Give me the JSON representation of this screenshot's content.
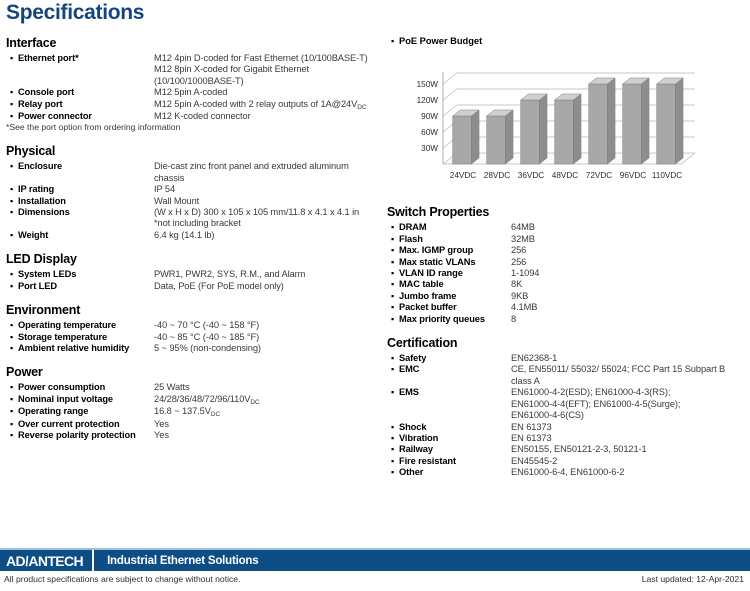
{
  "page": {
    "title": "Specifications"
  },
  "left_sections": [
    {
      "title": "Interface",
      "rows": [
        {
          "label": "Ethernet port*",
          "value_lines": [
            "M12 4pin D-coded for Fast Ethernet (10/100BASE-T)",
            "M12 8pin X-coded for Gigabit Ethernet",
            "(10/100/1000BASE-T)"
          ]
        },
        {
          "label": "Console port",
          "value_lines": [
            "M12 5pin A-coded"
          ]
        },
        {
          "label": "Relay port",
          "value_lines": [
            "M12 5pin A-coded with 2 relay outputs of 1A@24V<sub>DC</sub>"
          ]
        },
        {
          "label": "Power connector",
          "value_lines": [
            "M12 K-coded connector"
          ]
        }
      ],
      "footnote": "*See the port option from ordering information"
    },
    {
      "title": "Physical",
      "rows": [
        {
          "label": "Enclosure",
          "value_lines": [
            "Die-cast zinc front panel and extruded aluminum",
            "chassis"
          ]
        },
        {
          "label": "IP rating",
          "value_lines": [
            "IP 54"
          ]
        },
        {
          "label": "Installation",
          "value_lines": [
            "Wall Mount"
          ]
        },
        {
          "label": "Dimensions",
          "value_lines": [
            "(W x H x D) 300 x 105 x 105 mm/11.8 x 4.1 x 4.1 in",
            "*not including bracket"
          ]
        },
        {
          "label": "Weight",
          "value_lines": [
            "6.4 kg (14.1 lb)"
          ]
        }
      ],
      "footnote": ""
    },
    {
      "title": "LED Display",
      "rows": [
        {
          "label": "System LEDs",
          "value_lines": [
            "PWR1, PWR2, SYS, R.M., and Alarm"
          ]
        },
        {
          "label": "Port LED",
          "value_lines": [
            "Data, PoE (For PoE model only)"
          ]
        }
      ],
      "footnote": ""
    },
    {
      "title": "Environment",
      "rows": [
        {
          "label": "Operating temperature",
          "value_lines": [
            "-40 ~ 70 °C (-40 ~ 158 °F)"
          ]
        },
        {
          "label": "Storage temperature",
          "value_lines": [
            "-40 ~ 85 °C (-40 ~ 185 °F)"
          ]
        },
        {
          "label": "Ambient relative humidity",
          "value_lines": [
            "5 ~ 95% (non-condensing)"
          ]
        }
      ],
      "footnote": ""
    },
    {
      "title": "Power",
      "rows": [
        {
          "label": "Power consumption",
          "value_lines": [
            "25 Watts"
          ]
        },
        {
          "label": "Nominal input voltage",
          "value_lines": [
            "24/28/36/48/72/96/110V<sub>DC</sub>"
          ]
        },
        {
          "label": "Operating range",
          "value_lines": [
            "16.8 ~ 137.5V<sub>DC</sub>"
          ]
        },
        {
          "label": "Over current protection",
          "value_lines": [
            "Yes"
          ]
        },
        {
          "label": "Reverse polarity protection",
          "value_lines": [
            "Yes"
          ]
        }
      ],
      "footnote": ""
    }
  ],
  "chart_header": "PoE Power Budget",
  "chart_data": {
    "type": "bar",
    "title": "PoE Power Budget",
    "categories": [
      "24VDC",
      "28VDC",
      "36VDC",
      "48VDC",
      "72VDC",
      "96VDC",
      "110VDC"
    ],
    "values": [
      90,
      90,
      120,
      120,
      150,
      150,
      150
    ],
    "xlabel": "",
    "ylabel": "",
    "ylim": [
      0,
      180
    ],
    "ytick_values": [
      30,
      60,
      90,
      120,
      150
    ],
    "ytick_labels": [
      "30W",
      "60W",
      "90W",
      "120W",
      "150W"
    ],
    "grid": true,
    "legend": "none",
    "style": "3d-column",
    "bar_color": "#a8a8a8",
    "bar_top_color": "#cfcfcf",
    "bar_side_color": "#8d8d8d"
  },
  "right_sections": [
    {
      "title": "Switch Properties",
      "rows": [
        {
          "label": "DRAM",
          "value_lines": [
            "64MB"
          ]
        },
        {
          "label": "Flash",
          "value_lines": [
            "32MB"
          ]
        },
        {
          "label": "Max. IGMP group",
          "value_lines": [
            "256"
          ]
        },
        {
          "label": "Max static VLANs",
          "value_lines": [
            "256"
          ]
        },
        {
          "label": "VLAN ID range",
          "value_lines": [
            "1-1094"
          ]
        },
        {
          "label": "MAC table",
          "value_lines": [
            "8K"
          ]
        },
        {
          "label": "Jumbo frame",
          "value_lines": [
            "9KB"
          ]
        },
        {
          "label": "Packet buffer",
          "value_lines": [
            "4.1MB"
          ]
        },
        {
          "label": "Max priority queues",
          "value_lines": [
            "8"
          ]
        }
      ],
      "footnote": ""
    },
    {
      "title": "Certification",
      "rows": [
        {
          "label": "Safety",
          "value_lines": [
            "EN62368-1"
          ]
        },
        {
          "label": "EMC",
          "value_lines": [
            "CE, EN55011/ 55032/ 55024; FCC Part 15 Subpart B class A"
          ]
        },
        {
          "label": "EMS",
          "value_lines": [
            "EN61000-4-2(ESD); EN61000-4-3(RS);",
            "EN61000-4-4(EFT); EN61000-4-5(Surge);",
            "EN61000-4-6(CS)"
          ]
        },
        {
          "label": "Shock",
          "value_lines": [
            "EN 61373"
          ]
        },
        {
          "label": "Vibration",
          "value_lines": [
            "EN 61373"
          ]
        },
        {
          "label": "Railway",
          "value_lines": [
            "EN50155, EN50121-2-3, 50121-1"
          ]
        },
        {
          "label": "Fire resistant",
          "value_lines": [
            "EN45545-2"
          ]
        },
        {
          "label": "Other",
          "value_lines": [
            "EN61000-6-4, EN61000-6-2"
          ]
        }
      ],
      "footnote": ""
    }
  ],
  "footer": {
    "logo_pre": "AD",
    "logo_slash": "\\",
    "logo_post": "ANTECH",
    "tagline": "Industrial Ethernet Solutions",
    "note": "All product specifications are subject to change without notice.",
    "date": "Last updated: 12-Apr-2021"
  },
  "colors": {
    "title_blue": "#14457e",
    "footer_blue": "#0d4d86",
    "footer_rule": "#9fc0dc"
  }
}
